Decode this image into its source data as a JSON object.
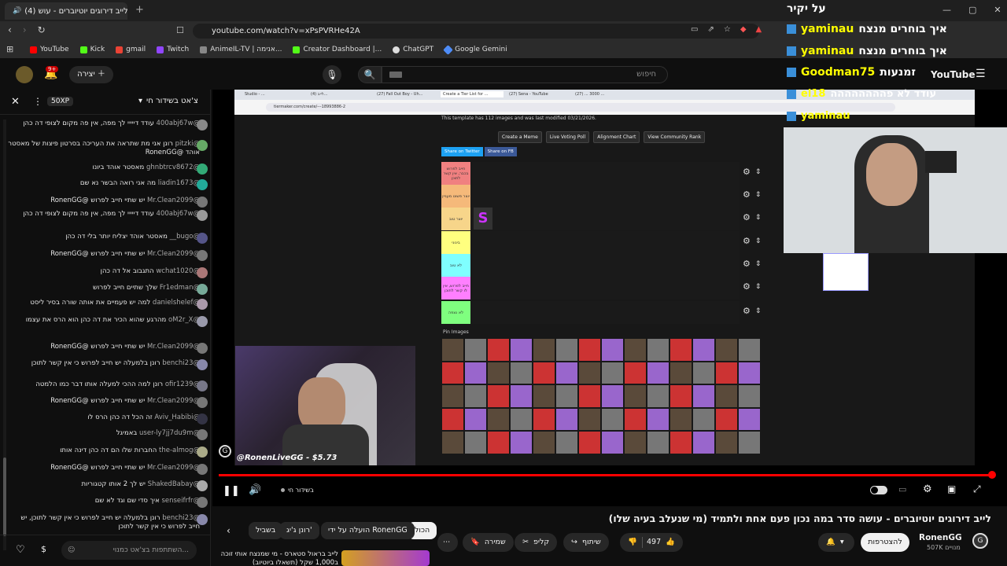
{
  "browser": {
    "tab_title": "(4) לייב דירוגים יוטיוברים - עוש",
    "url": "youtube.com/watch?v=xPsPVRHe42A",
    "bookmarks": [
      "YouTube",
      "Kick",
      "gmail",
      "Twitch",
      "AnimeIL-TV | אנימה...",
      "Creator Dashboard |...",
      "ChatGPT",
      "Google Gemini"
    ]
  },
  "yt_header": {
    "search_placeholder": "חיפוש",
    "create_label": "יצירה",
    "notif_count": "9+",
    "logo": "YouTube"
  },
  "chat": {
    "header_title": "צ'אט בשידור חי",
    "xp_badge": "50XP",
    "input_placeholder": "השתתפות בצ'אט כמנוי...",
    "messages": [
      {
        "author": "@400abj67w",
        "text": "עודד דייייי לך מפה, אין פה מקום לצופי דה כהן"
      },
      {
        "author": "@pitzki",
        "text": "רונן אני מת שתראה את העריכה בסרטון פיצות של מאסטר אוהד @RonenGG"
      },
      {
        "author": "@ghnbtrcv8672",
        "text": "מאסטר אוהד ביונו"
      },
      {
        "author": "@liadin1673",
        "text": "מה אני רואה הבשר נא שם"
      },
      {
        "author": "@Mr.Clean2099",
        "text": "יש שתיי חייב לפרוש @RonenGG"
      },
      {
        "author": "@400abj67w",
        "text": "עודד דייייי לך מפה, אין פה מקום לצופי דה כהן"
      },
      {
        "author": "@bugo__",
        "text": "מאסטר אוהד יצליח יותר בלי דה כהן"
      },
      {
        "author": "@Mr.Clean2099",
        "text": "יש שתיי חייב לפרוש @RonenGG"
      },
      {
        "author": "@wchat1020",
        "text": "התגבוב אל דה כהן"
      },
      {
        "author": "@Fr1edman",
        "text": "שלך שתיים חייב לפרוש"
      },
      {
        "author": "@danielshelef",
        "text": "למה יש פעמיים את אותה שורה בסיר ליסט"
      },
      {
        "author": "@oM2r_X",
        "text": "מהרגע שהוא הכיר את דה כהן הוא הרס את עצמו"
      },
      {
        "author": "@Mr.Clean2099",
        "text": "יש שתיי חייב לפרוש @RonenGG"
      },
      {
        "author": "@benchi23",
        "text": "רונן בלמעלה יש חייב לפרוש כי אין קשר לתוכן"
      },
      {
        "author": "@ofir1239",
        "text": "רונן למה ההכי למעלה אותו דבר כמו הלמטה"
      },
      {
        "author": "@Mr.Clean2099",
        "text": "יש שתיי חייב לפרוש @RonenGG"
      },
      {
        "author": "@Aviv_Habibi",
        "text": "זה הכל דה כהן הרס לו"
      },
      {
        "author": "@user-ly7jj7du9m",
        "text": "באמיגל"
      },
      {
        "author": "@the-almog",
        "text": "החברות שלו הם דה כהן דינה אותו"
      },
      {
        "author": "@Mr.Clean2099",
        "text": "יש שתיי חייב לפרוש @RonenGG"
      },
      {
        "author": "@ShakedBabay",
        "text": "יש לך 2 אותו קטגוריות"
      },
      {
        "author": "@senseifrfr",
        "text": "איך סדי שם וגד לא שם"
      },
      {
        "author": "@benchi23",
        "text": "רונן בלמעלה יש חייב לפרוש כי אין קשר לתוכן, יש חייב לפרוש כי אין קשר לתוכן"
      }
    ]
  },
  "tierlist": {
    "info": "This template has 112 images and was last modified 03/21/2026.",
    "buttons": [
      "Create a Meme",
      "Live Voting Poll",
      "Alignment Chart",
      "View Community Rank"
    ],
    "share": [
      "Share on Twitter",
      "Share on FB"
    ],
    "rows": [
      {
        "label": "חייב לפרוש בכבר, אין קשר לתוכן",
        "color": "#f08080"
      },
      {
        "label": "יוצר פשוט מעניין",
        "color": "#f5b97a"
      },
      {
        "label": "יוצר טוב",
        "color": "#f7d58a"
      },
      {
        "label": "בינוני",
        "color": "#ffff7f"
      },
      {
        "label": "לא טוב",
        "color": "#7fffff"
      },
      {
        "label": "חייב לפרוש, אין לו קשר לתוכן",
        "color": "#ff7fff"
      },
      {
        "label": "לא נצפה",
        "color": "#7fff7f"
      }
    ],
    "pin_label": "Pin Images",
    "inner_url": "tiermaker.com/create/---18993886-2",
    "inner_tabs": [
      "Studio - ...",
      "(4) לייב...",
      "(27) Fall Out Boy - Uh...",
      "Create a Tier List for ...",
      "(27) Sena - YouTube",
      "(27) ... 3000 ..."
    ]
  },
  "streamer_overlay": {
    "donation": "@RonenLiveGG - $5.73"
  },
  "overlay_chat": [
    {
      "name": "על יקיר",
      "text": ""
    },
    {
      "name": "yaminau",
      "text": "איך בוחרים מנצח"
    },
    {
      "name": "yaminau",
      "text": "איך בוחרים מנצח"
    },
    {
      "name": "Goodman75",
      "text": "זמנעות"
    },
    {
      "name": "el18",
      "text": "עודד לא פהההההההה"
    },
    {
      "name": "yaminau",
      "text": ""
    }
  ],
  "player": {
    "live_label": "בשידור חי"
  },
  "video": {
    "title": "לייב דירוגים יוטיוברים - עושה סדר במה נכון פעם אחת ולתמיד (מי שנעלב בעיה שלו)",
    "channel": "RonenGG",
    "subs": "507K מנויים",
    "subscribe": "להצטרפות",
    "likes": "497",
    "share": "שיתוף",
    "clip": "קליפ",
    "save": "שמירה"
  },
  "related_chips": [
    "הכול",
    "הועלה על ידי RonenGG",
    "רונן ג'יג'",
    "בשביל"
  ],
  "related_video_title": "לייב בראול סטארס - מי שמנצח אותי זוכה ב1,000 שקל (תשאלו ביוטיוב)",
  "colors": {
    "accent": "#ff0000",
    "subscribe_bg": "#f1f1f1",
    "bg": "#0f0f0f"
  }
}
